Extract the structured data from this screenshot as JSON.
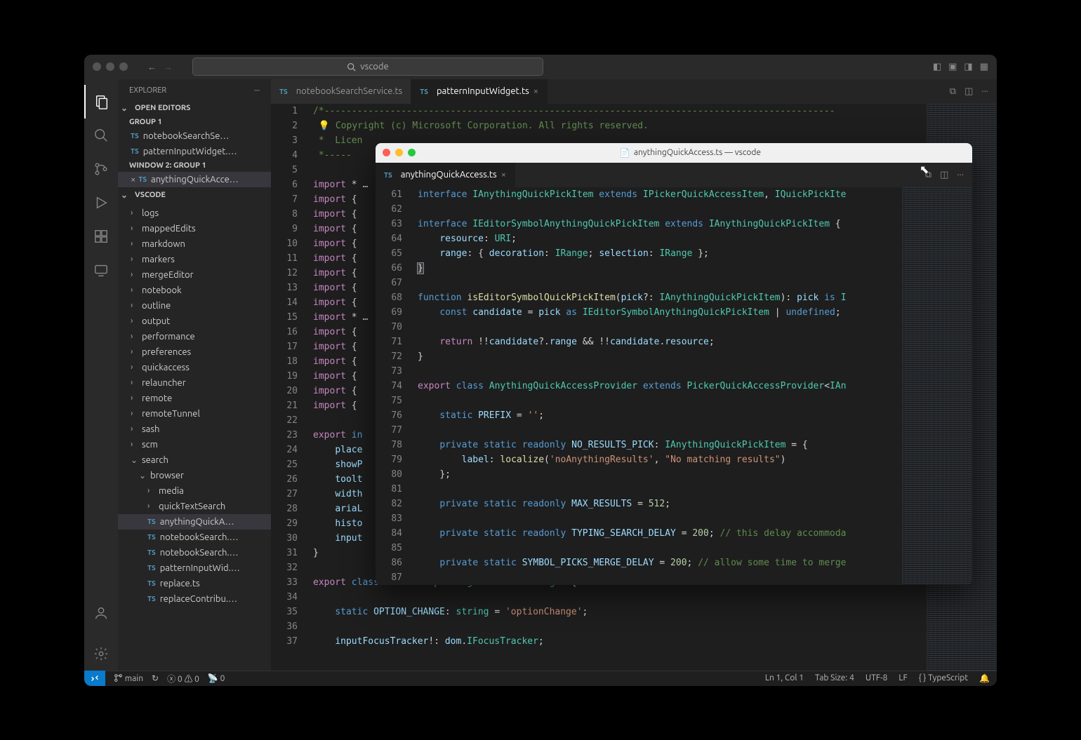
{
  "header": {
    "search_placeholder": "vscode"
  },
  "sidebar": {
    "title": "EXPLORER",
    "sections": {
      "open_editors": "OPEN EDITORS",
      "group1": "GROUP 1",
      "open_group1_items": [
        "notebookSearchSe…",
        "patternInputWidget.…"
      ],
      "window2_group1": "WINDOW 2: GROUP 1",
      "win2_item": "anythingQuickAcce…",
      "workspace_name": "VSCODE",
      "folders": [
        "logs",
        "mappedEdits",
        "markdown",
        "markers",
        "mergeEditor",
        "notebook",
        "outline",
        "output",
        "performance",
        "preferences",
        "quickaccess",
        "relauncher",
        "remote",
        "remoteTunnel",
        "sash",
        "scm"
      ],
      "search_folder": "search",
      "browser_folder": "browser",
      "browser_children": [
        "media",
        "quickTextSearch"
      ],
      "ts_files": [
        "anythingQuickA…",
        "notebookSearch.…",
        "notebookSearch.…",
        "patternInputWid.…",
        "replace.ts",
        "replaceContribu.…"
      ]
    }
  },
  "tabs": [
    {
      "label": "notebookSearchService.ts",
      "active": false
    },
    {
      "label": "patternInputWidget.ts",
      "active": true
    }
  ],
  "editor1": {
    "lines": [
      {
        "n": 1,
        "html": "<span class='tok-c'>/*---------------------------------------------------------------------------------------------</span>"
      },
      {
        "n": 2,
        "html": " <span class='bulb'>💡</span> <span class='tok-c'>Copyright (c) Microsoft Corporation. All rights reserved.</span>"
      },
      {
        "n": 3,
        "html": "<span class='tok-c'> *  Licen</span>"
      },
      {
        "n": 4,
        "html": "<span class='tok-c'> *-----</span>"
      },
      {
        "n": 5,
        "html": ""
      },
      {
        "n": 6,
        "html": "<span class='tok-k'>import</span> <span class='tok-p'>*</span> <span class='tok-p'>…</span>"
      },
      {
        "n": 7,
        "html": "<span class='tok-k'>import</span> <span class='tok-p'>{</span>"
      },
      {
        "n": 8,
        "html": "<span class='tok-k'>import</span> <span class='tok-p'>{</span>"
      },
      {
        "n": 9,
        "html": "<span class='tok-k'>import</span> <span class='tok-p'>{</span>"
      },
      {
        "n": 10,
        "html": "<span class='tok-k'>import</span> <span class='tok-p'>{</span>"
      },
      {
        "n": 11,
        "html": "<span class='tok-k'>import</span> <span class='tok-p'>{</span>"
      },
      {
        "n": 12,
        "html": "<span class='tok-k'>import</span> <span class='tok-p'>{</span>"
      },
      {
        "n": 13,
        "html": "<span class='tok-k'>import</span> <span class='tok-p'>{</span>"
      },
      {
        "n": 14,
        "html": "<span class='tok-k'>import</span> <span class='tok-p'>{</span>"
      },
      {
        "n": 15,
        "html": "<span class='tok-k'>import</span> <span class='tok-p'>*</span> <span class='tok-p'>…</span>"
      },
      {
        "n": 16,
        "html": "<span class='tok-k'>import</span> <span class='tok-p'>{</span>"
      },
      {
        "n": 17,
        "html": "<span class='tok-k'>import</span> <span class='tok-p'>{</span>"
      },
      {
        "n": 18,
        "html": "<span class='tok-k'>import</span> <span class='tok-p'>{</span>"
      },
      {
        "n": 19,
        "html": "<span class='tok-k'>import</span> <span class='tok-p'>{</span>"
      },
      {
        "n": 20,
        "html": "<span class='tok-k'>import</span> <span class='tok-p'>{</span>"
      },
      {
        "n": 21,
        "html": "<span class='tok-k'>import</span> <span class='tok-p'>{</span>"
      },
      {
        "n": 22,
        "html": ""
      },
      {
        "n": 23,
        "html": "<span class='tok-k'>export</span> <span class='tok-bl'>in</span>"
      },
      {
        "n": 24,
        "html": "    <span class='tok-v'>place</span>"
      },
      {
        "n": 25,
        "html": "    <span class='tok-v'>showP</span>"
      },
      {
        "n": 26,
        "html": "    <span class='tok-v'>toolt</span>"
      },
      {
        "n": 27,
        "html": "    <span class='tok-v'>width</span>"
      },
      {
        "n": 28,
        "html": "    <span class='tok-v'>ariaL</span>"
      },
      {
        "n": 29,
        "html": "    <span class='tok-v'>histo</span>"
      },
      {
        "n": 30,
        "html": "    <span class='tok-v'>input</span>"
      },
      {
        "n": 31,
        "html": "<span class='tok-p'>}</span>"
      },
      {
        "n": 32,
        "html": ""
      },
      {
        "n": 33,
        "html": "<span class='tok-k'>export</span> <span class='tok-bl'>class</span> <span class='tok-t'>PatternInputWidget</span> <span class='tok-bl'>extends</span> <span class='tok-t'>Widget</span> <span class='tok-p'>{</span>"
      },
      {
        "n": 34,
        "html": ""
      },
      {
        "n": 35,
        "html": "    <span class='tok-bl'>static</span> <span class='tok-v'>OPTION_CHANGE</span><span class='tok-p'>:</span> <span class='tok-t'>string</span> <span class='tok-p'>=</span> <span class='tok-s'>'optionChange'</span><span class='tok-p'>;</span>"
      },
      {
        "n": 36,
        "html": ""
      },
      {
        "n": 37,
        "html": "    <span class='tok-v'>inputFocusTracker</span><span class='tok-p'>!:</span> <span class='tok-v'>dom</span><span class='tok-p'>.</span><span class='tok-t'>IFocusTracker</span><span class='tok-p'>;</span>"
      }
    ]
  },
  "floating": {
    "title": "anythingQuickAccess.ts — vscode",
    "tab_label": "anythingQuickAccess.ts",
    "lines": [
      {
        "n": 61,
        "html": "<span class='tok-bl'>interface</span> <span class='tok-t'>IAnythingQuickPickItem</span> <span class='tok-bl'>extends</span> <span class='tok-t'>IPickerQuickAccessItem</span><span class='tok-p'>,</span> <span class='tok-t'>IQuickPickIte</span>"
      },
      {
        "n": 62,
        "html": ""
      },
      {
        "n": 63,
        "html": "<span class='tok-bl'>interface</span> <span class='tok-t'>IEditorSymbolAnythingQuickPickItem</span> <span class='tok-bl'>extends</span> <span class='tok-t'>IAnythingQuickPickItem</span> <span class='tok-p'>{</span>"
      },
      {
        "n": 64,
        "html": "    <span class='tok-v'>resource</span><span class='tok-p'>:</span> <span class='tok-t'>URI</span><span class='tok-p'>;</span>"
      },
      {
        "n": 65,
        "html": "    <span class='tok-v'>range</span><span class='tok-p'>: {</span> <span class='tok-v'>decoration</span><span class='tok-p'>:</span> <span class='tok-t'>IRange</span><span class='tok-p'>;</span> <span class='tok-v'>selection</span><span class='tok-p'>:</span> <span class='tok-t'>IRange</span> <span class='tok-p'>};</span>"
      },
      {
        "n": 66,
        "html": "<span class='tok-p' style='background:#3a3d41;outline:1px solid #888'>}</span>"
      },
      {
        "n": 67,
        "html": ""
      },
      {
        "n": 68,
        "html": "<span class='tok-bl'>function</span> <span class='tok-f'>isEditorSymbolQuickPickItem</span><span class='tok-p'>(</span><span class='tok-v'>pick</span><span class='tok-p'>?:</span> <span class='tok-t'>IAnythingQuickPickItem</span><span class='tok-p'>):</span> <span class='tok-v'>pick</span> <span class='tok-bl'>is</span> <span class='tok-t'>I</span>"
      },
      {
        "n": 69,
        "html": "    <span class='tok-bl'>const</span> <span class='tok-v'>candidate</span> <span class='tok-p'>=</span> <span class='tok-v'>pick</span> <span class='tok-bl'>as</span> <span class='tok-t'>IEditorSymbolAnythingQuickPickItem</span> <span class='tok-p'>|</span> <span class='tok-bl'>undefined</span><span class='tok-p'>;</span>"
      },
      {
        "n": 70,
        "html": ""
      },
      {
        "n": 71,
        "html": "    <span class='tok-k'>return</span> <span class='tok-p'>!!</span><span class='tok-v'>candidate</span><span class='tok-p'>?.</span><span class='tok-v'>range</span> <span class='tok-p'>&amp;&amp;</span> <span class='tok-p'>!!</span><span class='tok-v'>candidate</span><span class='tok-p'>.</span><span class='tok-v'>resource</span><span class='tok-p'>;</span>"
      },
      {
        "n": 72,
        "html": "<span class='tok-p'>}</span>"
      },
      {
        "n": 73,
        "html": ""
      },
      {
        "n": 74,
        "html": "<span class='tok-k'>export</span> <span class='tok-bl'>class</span> <span class='tok-t'>AnythingQuickAccessProvider</span> <span class='tok-bl'>extends</span> <span class='tok-t'>PickerQuickAccessProvider</span><span class='tok-p'>&lt;</span><span class='tok-t'>IAn</span>"
      },
      {
        "n": 75,
        "html": ""
      },
      {
        "n": 76,
        "html": "    <span class='tok-bl'>static</span> <span class='tok-v'>PREFIX</span> <span class='tok-p'>=</span> <span class='tok-s'>''</span><span class='tok-p'>;</span>"
      },
      {
        "n": 77,
        "html": ""
      },
      {
        "n": 78,
        "html": "    <span class='tok-bl'>private static readonly</span> <span class='tok-v'>NO_RESULTS_PICK</span><span class='tok-p'>:</span> <span class='tok-t'>IAnythingQuickPickItem</span> <span class='tok-p'>= {</span>"
      },
      {
        "n": 79,
        "html": "        <span class='tok-v'>label</span><span class='tok-p'>:</span> <span class='tok-f'>localize</span><span class='tok-p'>(</span><span class='tok-s'>'noAnythingResults'</span><span class='tok-p'>,</span> <span class='tok-s'>\"No matching results\"</span><span class='tok-p'>)</span>"
      },
      {
        "n": 80,
        "html": "    <span class='tok-p'>};</span>"
      },
      {
        "n": 81,
        "html": ""
      },
      {
        "n": 82,
        "html": "    <span class='tok-bl'>private static readonly</span> <span class='tok-v'>MAX_RESULTS</span> <span class='tok-p'>=</span> <span class='tok-n'>512</span><span class='tok-p'>;</span>"
      },
      {
        "n": 83,
        "html": ""
      },
      {
        "n": 84,
        "html": "    <span class='tok-bl'>private static readonly</span> <span class='tok-v'>TYPING_SEARCH_DELAY</span> <span class='tok-p'>=</span> <span class='tok-n'>200</span><span class='tok-p'>;</span> <span class='tok-c'>// this delay accommoda</span>"
      },
      {
        "n": 85,
        "html": ""
      },
      {
        "n": 86,
        "html": "    <span class='tok-bl'>private static</span> <span class='tok-v'>SYMBOL_PICKS_MERGE_DELAY</span> <span class='tok-p'>=</span> <span class='tok-n'>200</span><span class='tok-p'>;</span> <span class='tok-c'>// allow some time to merge</span>"
      },
      {
        "n": 87,
        "html": ""
      }
    ]
  },
  "status": {
    "branch": "main",
    "errors": "0",
    "warnings": "0",
    "ports": "0",
    "ln_col": "Ln 1, Col 1",
    "tab_size": "Tab Size: 4",
    "encoding": "UTF-8",
    "eol": "LF",
    "lang_icon": "{ }",
    "lang": "TypeScript"
  }
}
